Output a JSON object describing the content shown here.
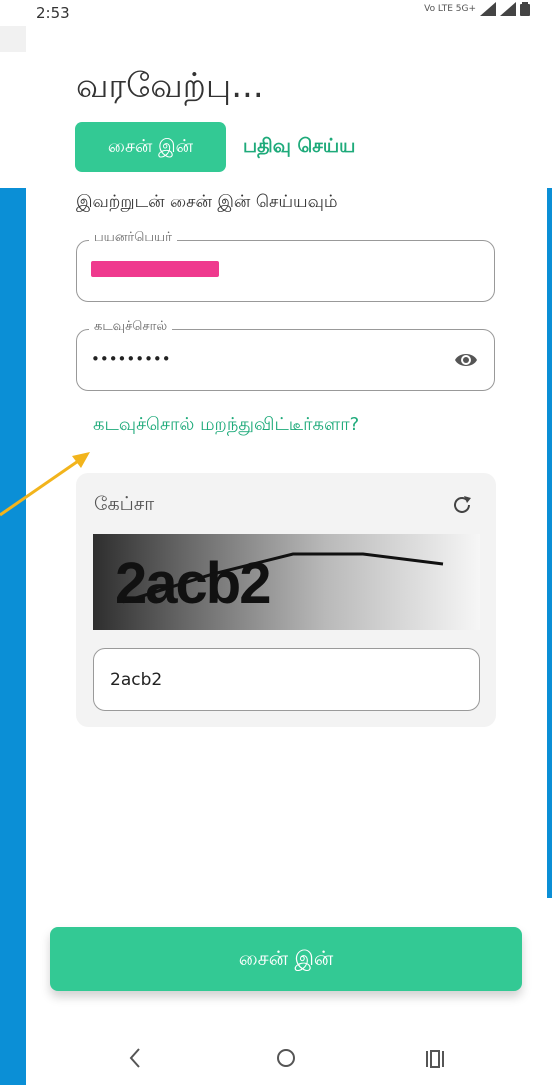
{
  "status_bar": {
    "time": "2:53",
    "network_label": "Vo LTE 5G+",
    "icons": [
      "signal-icon",
      "signal-r-icon",
      "battery-icon"
    ]
  },
  "title": "வரவேற்பு...",
  "tabs": {
    "signin": "சைன் இன்",
    "register": "பதிவு செய்ய"
  },
  "subtitle": "இவற்றுடன் சைன் இன் செய்யவும்",
  "username": {
    "label": "பயனர்பெயர்",
    "value": ""
  },
  "password": {
    "label": "கடவுச்சொல்",
    "value": "•••••••••"
  },
  "forgot_password": "கடவுச்சொல் மறந்துவிட்டீர்களா?",
  "captcha": {
    "title": "கேப்சா",
    "image_text": "2acb2",
    "input_value": "2acb2"
  },
  "submit": "சைன் இன்",
  "colors": {
    "accent": "#33c994",
    "accent_text": "#1eaa7a",
    "side_blue": "#0b8fd6",
    "redaction": "#ef3a8e",
    "arrow": "#f2b41c"
  }
}
